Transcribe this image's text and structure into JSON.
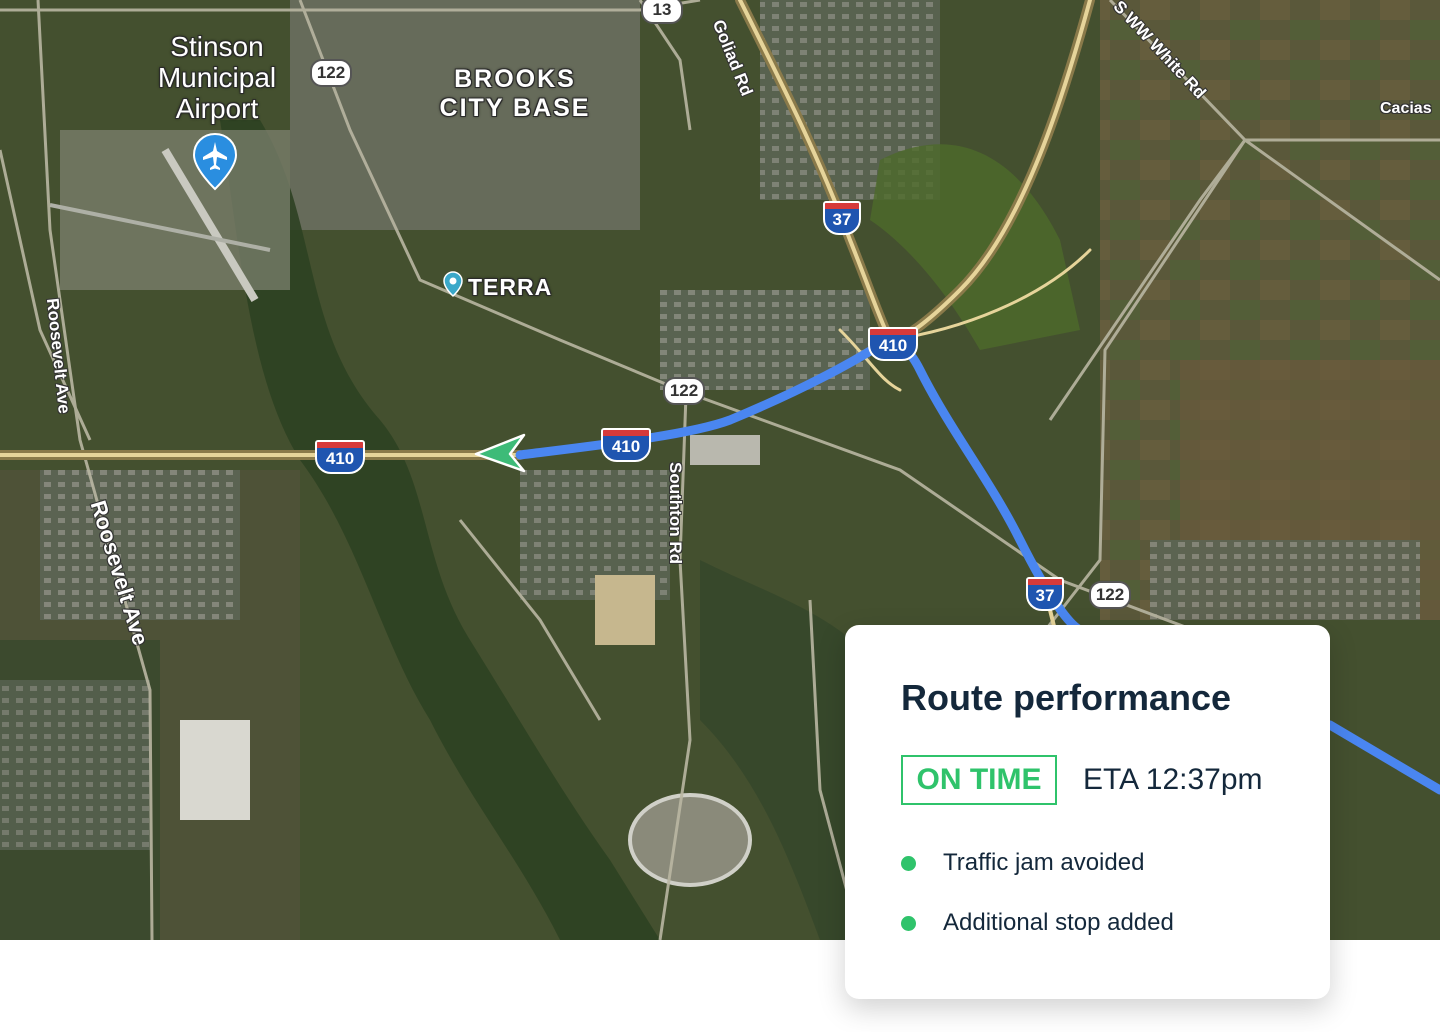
{
  "map": {
    "places": {
      "airport": "Stinson\nMunicipal\nAirport",
      "base": "BROOKS\nCITY BASE",
      "terra": "TERRA",
      "cacias": "Cacias"
    },
    "roads": {
      "goliad": "Goliad Rd",
      "white": "S WW White Rd",
      "roosevelt_upper": "Roosevelt Ave",
      "roosevelt_lower": "Roosevelt Ave",
      "southton": "Southton Rd"
    },
    "shields": {
      "sh13": "13",
      "sh122_a": "122",
      "sh122_b": "122",
      "sh122_c": "122",
      "i37_a": "37",
      "i37_b": "37",
      "i410_a": "410",
      "i410_b": "410",
      "i410_c": "410"
    },
    "route_color": "#4a86f0",
    "arrow_color": "#3dbb78",
    "airport_pin_color": "#2a8ee0",
    "icons": [
      "airport-pin-icon",
      "location-pin-icon",
      "navigation-arrow-icon"
    ]
  },
  "card": {
    "title": "Route performance",
    "status": "ON TIME",
    "eta": "ETA 12:37pm",
    "bullets": [
      "Traffic jam avoided",
      "Additional stop added"
    ],
    "accent_color": "#2fc36b",
    "text_color": "#14283b"
  }
}
